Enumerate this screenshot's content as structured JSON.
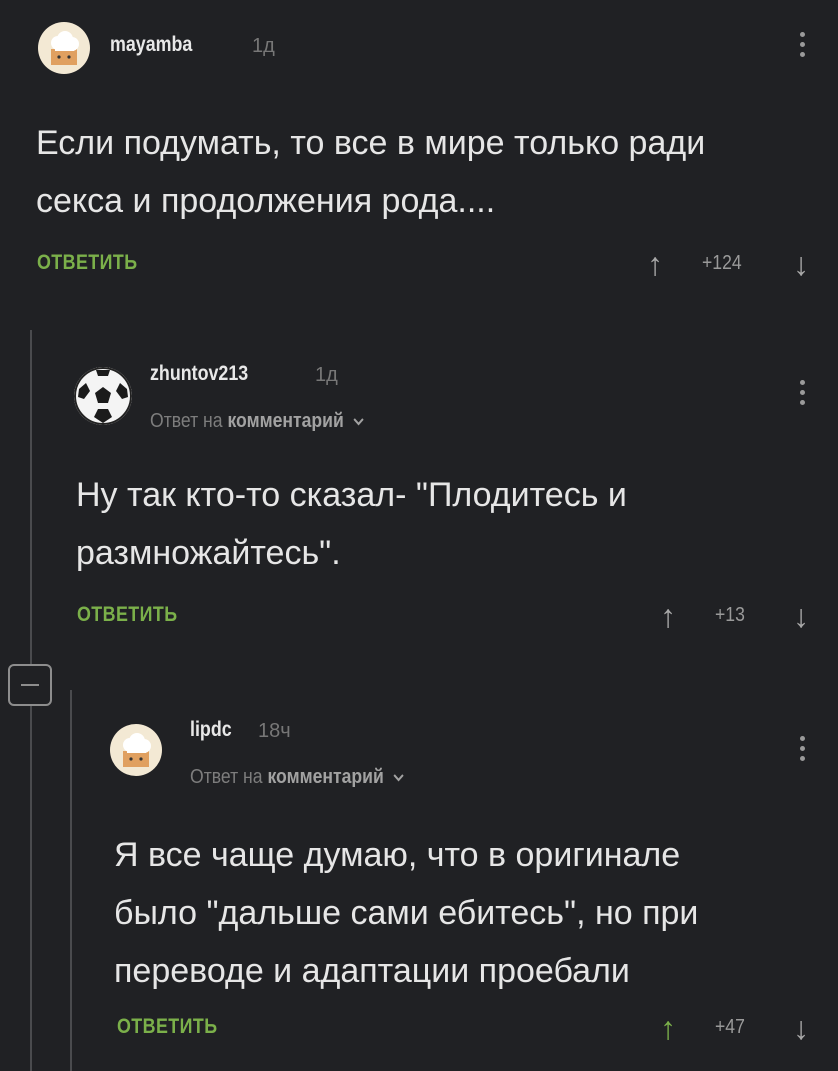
{
  "comments": [
    {
      "username": "mayamba",
      "ago": "1д",
      "lines": [
        "Если подумать, то все в мире только ради",
        "секса и продолжения рода...."
      ],
      "reply_label": "ОТВЕТИТЬ",
      "rating": "+124"
    },
    {
      "username": "zhuntov213",
      "ago": "1д",
      "reply_prefix": "Ответ на",
      "reply_target": "комментарий",
      "lines": [
        "Ну так кто-то сказал- \"Плодитесь и",
        "размножайтесь\"."
      ],
      "reply_label": "ОТВЕТИТЬ",
      "rating": "+13"
    },
    {
      "username": "lipdc",
      "ago": "18ч",
      "reply_prefix": "Ответ на",
      "reply_target": "комментарий",
      "lines": [
        "Я все чаще думаю, что в оригинале",
        "было \"дальше сами ебитесь\", но при",
        "переводе и адаптации проебали"
      ],
      "reply_label": "ОТВЕТИТЬ",
      "rating": "+47"
    }
  ],
  "icons": {
    "avatar_1": "chef-hat-avatar",
    "avatar_2": "soccer-ball-avatar",
    "avatar_3": "chef-hat-avatar",
    "vote_up": "↑",
    "vote_down": "↓",
    "reply_chevron": "chevron-down-icon"
  },
  "colors": {
    "background": "#202124",
    "accent_green": "#7bb04a"
  }
}
